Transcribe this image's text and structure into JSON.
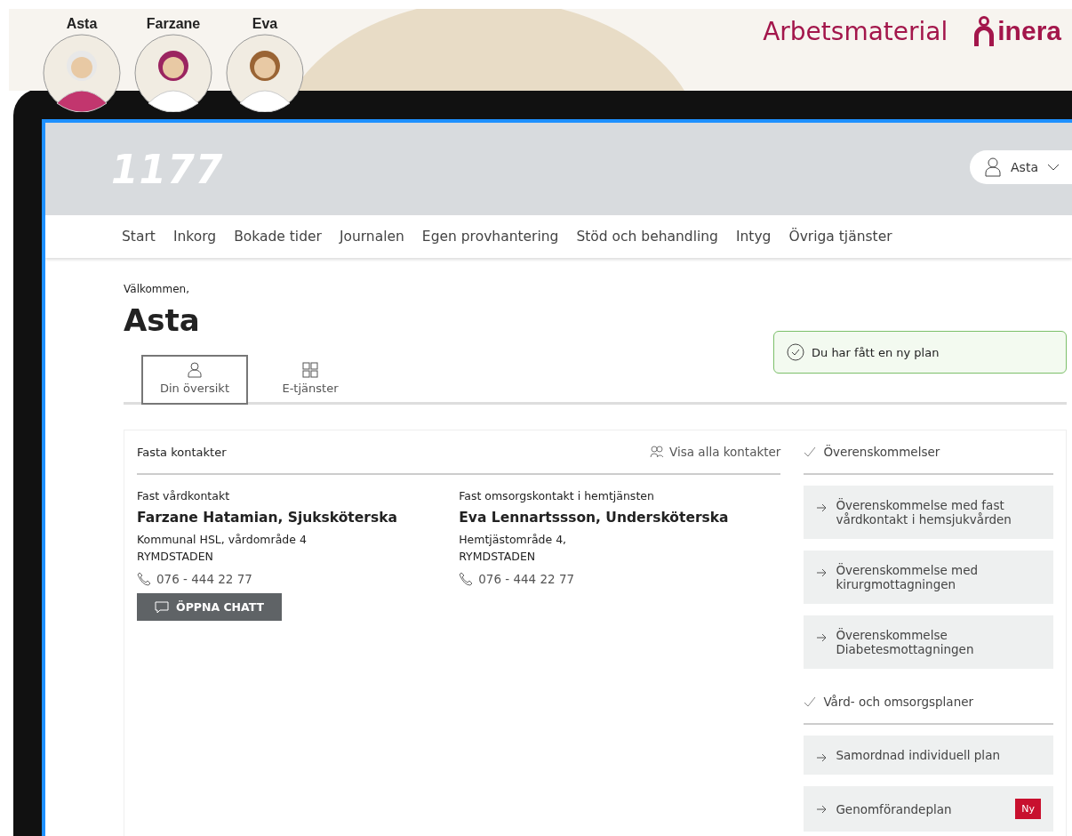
{
  "banner": {
    "personas": [
      {
        "name": "Asta",
        "kind": "elder"
      },
      {
        "name": "Farzane",
        "kind": "nurse"
      },
      {
        "name": "Eva",
        "kind": "carer"
      }
    ],
    "title": "Arbetsmaterial",
    "logo_text": "inera"
  },
  "header": {
    "logo": "1177",
    "user_menu": {
      "label": "Asta"
    }
  },
  "nav": [
    {
      "label": "Start"
    },
    {
      "label": "Inkorg"
    },
    {
      "label": "Bokade tider"
    },
    {
      "label": "Journalen"
    },
    {
      "label": "Egen provhantering"
    },
    {
      "label": "Stöd och behandling"
    },
    {
      "label": "Intyg"
    },
    {
      "label": "Övriga tjänster"
    }
  ],
  "welcome": {
    "greeting": "Välkommen,",
    "name": "Asta"
  },
  "view_tabs": [
    {
      "label": "Din översikt",
      "selected": true,
      "kind": "person"
    },
    {
      "label": "E-tjänster",
      "selected": false,
      "kind": "grid"
    }
  ],
  "notice": {
    "text": "Du har fått en ny plan"
  },
  "contacts": {
    "title": "Fasta kontakter",
    "link": "Visa alla kontakter",
    "items": [
      {
        "role": "Fast vårdkontakt",
        "name": "Farzane Hatamian, Sjuksköterska",
        "address": [
          "Kommunal HSL, vårdområde 4",
          "RYMDSTADEN"
        ],
        "phone": "076 - 444 22 77",
        "action": "ÖPPNA CHATT"
      },
      {
        "role": "Fast omsorgskontakt i hemtjänsten",
        "name": "Eva Lennartssson, Undersköterska",
        "address": [
          "Hemtjästområde 4,",
          "RYMDSTADEN"
        ],
        "phone": "076 - 444 22 77"
      }
    ]
  },
  "sections": [
    {
      "title": "Överenskommelser",
      "items": [
        {
          "label": "Överenskommelse med fast vårdkontakt i hemsjukvården"
        },
        {
          "label": "Överenskommelse med kirurgmottagningen"
        },
        {
          "label": "Överenskommelse Diabetesmottagningen"
        }
      ]
    },
    {
      "title": "Vård- och omsorgsplaner",
      "items": [
        {
          "label": "Samordnad individuell plan"
        },
        {
          "label": "Genomförandeplan",
          "badge": "Ny"
        }
      ]
    }
  ]
}
